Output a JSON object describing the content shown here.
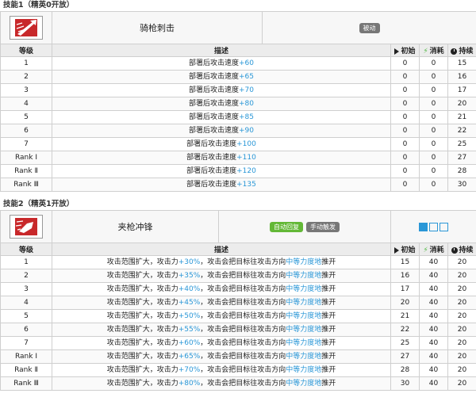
{
  "skills": [
    {
      "section_title": "技能1（精英0开放）",
      "name": "骑枪刺击",
      "tags": [
        {
          "label": "被动",
          "color": "gray"
        }
      ],
      "columns": {
        "level": "等级",
        "desc": "描述",
        "init": "初始",
        "cost": "消耗",
        "duration": "持续"
      },
      "rows": [
        {
          "level": "1",
          "desc_pre": "部署后攻击速度",
          "desc_hl": "+60",
          "desc_mid": "",
          "desc_hl2": "",
          "desc_post": "",
          "init": "0",
          "cost": "0",
          "duration": "15"
        },
        {
          "level": "2",
          "desc_pre": "部署后攻击速度",
          "desc_hl": "+65",
          "desc_mid": "",
          "desc_hl2": "",
          "desc_post": "",
          "init": "0",
          "cost": "0",
          "duration": "16"
        },
        {
          "level": "3",
          "desc_pre": "部署后攻击速度",
          "desc_hl": "+70",
          "desc_mid": "",
          "desc_hl2": "",
          "desc_post": "",
          "init": "0",
          "cost": "0",
          "duration": "17"
        },
        {
          "level": "4",
          "desc_pre": "部署后攻击速度",
          "desc_hl": "+80",
          "desc_mid": "",
          "desc_hl2": "",
          "desc_post": "",
          "init": "0",
          "cost": "0",
          "duration": "20"
        },
        {
          "level": "5",
          "desc_pre": "部署后攻击速度",
          "desc_hl": "+85",
          "desc_mid": "",
          "desc_hl2": "",
          "desc_post": "",
          "init": "0",
          "cost": "0",
          "duration": "21"
        },
        {
          "level": "6",
          "desc_pre": "部署后攻击速度",
          "desc_hl": "+90",
          "desc_mid": "",
          "desc_hl2": "",
          "desc_post": "",
          "init": "0",
          "cost": "0",
          "duration": "22"
        },
        {
          "level": "7",
          "desc_pre": "部署后攻击速度",
          "desc_hl": "+100",
          "desc_mid": "",
          "desc_hl2": "",
          "desc_post": "",
          "init": "0",
          "cost": "0",
          "duration": "25"
        },
        {
          "level": "Rank Ⅰ",
          "desc_pre": "部署后攻击速度",
          "desc_hl": "+110",
          "desc_mid": "",
          "desc_hl2": "",
          "desc_post": "",
          "init": "0",
          "cost": "0",
          "duration": "27"
        },
        {
          "level": "Rank Ⅱ",
          "desc_pre": "部署后攻击速度",
          "desc_hl": "+120",
          "desc_mid": "",
          "desc_hl2": "",
          "desc_post": "",
          "init": "0",
          "cost": "0",
          "duration": "28"
        },
        {
          "level": "Rank Ⅲ",
          "desc_pre": "部署后攻击速度",
          "desc_hl": "+135",
          "desc_mid": "",
          "desc_hl2": "",
          "desc_post": "",
          "init": "0",
          "cost": "0",
          "duration": "30"
        }
      ]
    },
    {
      "section_title": "技能2（精英1开放）",
      "name": "夹枪冲锋",
      "tags": [
        {
          "label": "自动回复",
          "color": "green"
        },
        {
          "label": "手动触发",
          "color": "gray"
        }
      ],
      "columns": {
        "level": "等级",
        "desc": "描述",
        "init": "初始",
        "cost": "消耗",
        "duration": "持续"
      },
      "rows": [
        {
          "level": "1",
          "desc_pre": "攻击范围扩大，攻击力",
          "desc_hl": "+30%",
          "desc_mid": "，攻击会把目标往攻击方向",
          "desc_hl2": "中等力度地",
          "desc_post": "推开",
          "init": "15",
          "cost": "40",
          "duration": "20"
        },
        {
          "level": "2",
          "desc_pre": "攻击范围扩大，攻击力",
          "desc_hl": "+35%",
          "desc_mid": "，攻击会把目标往攻击方向",
          "desc_hl2": "中等力度地",
          "desc_post": "推开",
          "init": "16",
          "cost": "40",
          "duration": "20"
        },
        {
          "level": "3",
          "desc_pre": "攻击范围扩大，攻击力",
          "desc_hl": "+40%",
          "desc_mid": "，攻击会把目标往攻击方向",
          "desc_hl2": "中等力度地",
          "desc_post": "推开",
          "init": "17",
          "cost": "40",
          "duration": "20"
        },
        {
          "level": "4",
          "desc_pre": "攻击范围扩大，攻击力",
          "desc_hl": "+45%",
          "desc_mid": "，攻击会把目标往攻击方向",
          "desc_hl2": "中等力度地",
          "desc_post": "推开",
          "init": "20",
          "cost": "40",
          "duration": "20"
        },
        {
          "level": "5",
          "desc_pre": "攻击范围扩大，攻击力",
          "desc_hl": "+50%",
          "desc_mid": "，攻击会把目标往攻击方向",
          "desc_hl2": "中等力度地",
          "desc_post": "推开",
          "init": "21",
          "cost": "40",
          "duration": "20"
        },
        {
          "level": "6",
          "desc_pre": "攻击范围扩大，攻击力",
          "desc_hl": "+55%",
          "desc_mid": "，攻击会把目标往攻击方向",
          "desc_hl2": "中等力度地",
          "desc_post": "推开",
          "init": "22",
          "cost": "40",
          "duration": "20"
        },
        {
          "level": "7",
          "desc_pre": "攻击范围扩大，攻击力",
          "desc_hl": "+60%",
          "desc_mid": "，攻击会把目标往攻击方向",
          "desc_hl2": "中等力度地",
          "desc_post": "推开",
          "init": "25",
          "cost": "40",
          "duration": "20"
        },
        {
          "level": "Rank Ⅰ",
          "desc_pre": "攻击范围扩大，攻击力",
          "desc_hl": "+65%",
          "desc_mid": "，攻击会把目标往攻击方向",
          "desc_hl2": "中等力度地",
          "desc_post": "推开",
          "init": "27",
          "cost": "40",
          "duration": "20"
        },
        {
          "level": "Rank Ⅱ",
          "desc_pre": "攻击范围扩大，攻击力",
          "desc_hl": "+70%",
          "desc_mid": "，攻击会把目标往攻击方向",
          "desc_hl2": "中等力度地",
          "desc_post": "推开",
          "init": "28",
          "cost": "40",
          "duration": "20"
        },
        {
          "level": "Rank Ⅲ",
          "desc_pre": "攻击范围扩大，攻击力",
          "desc_hl": "+80%",
          "desc_mid": "，攻击会把目标往攻击方向",
          "desc_hl2": "中等力度地",
          "desc_post": "推开",
          "init": "30",
          "cost": "40",
          "duration": "20"
        }
      ]
    }
  ],
  "colors": {
    "highlight": "#2a97d7",
    "green_tag": "#63b837",
    "gray_tag": "#777777"
  }
}
